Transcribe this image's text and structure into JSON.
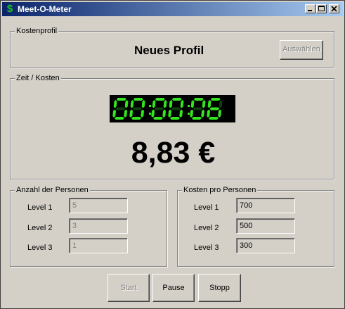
{
  "window": {
    "title": "Meet-O-Meter",
    "app_icon": "$"
  },
  "profile": {
    "group_label": "Kostenprofil",
    "name": "Neues Profil",
    "select_button": "Auswählen"
  },
  "time_cost": {
    "group_label": "Zeit / Kosten",
    "timer": "00:00:06",
    "cost": "8,83 €"
  },
  "persons": {
    "group_label": "Anzahl der Personen",
    "rows": [
      {
        "label": "Level 1",
        "value": "5"
      },
      {
        "label": "Level 2",
        "value": "3"
      },
      {
        "label": "Level 3",
        "value": "1"
      }
    ]
  },
  "costs": {
    "group_label": "Kosten pro Personen",
    "rows": [
      {
        "label": "Level 1",
        "value": "700"
      },
      {
        "label": "Level 2",
        "value": "500"
      },
      {
        "label": "Level 3",
        "value": "300"
      }
    ]
  },
  "buttons": {
    "start": "Start",
    "pause": "Pause",
    "stop": "Stopp"
  },
  "colors": {
    "lcd_on": "#33e41f",
    "lcd_off": "#103c10",
    "titlebar": "#0a246a"
  }
}
